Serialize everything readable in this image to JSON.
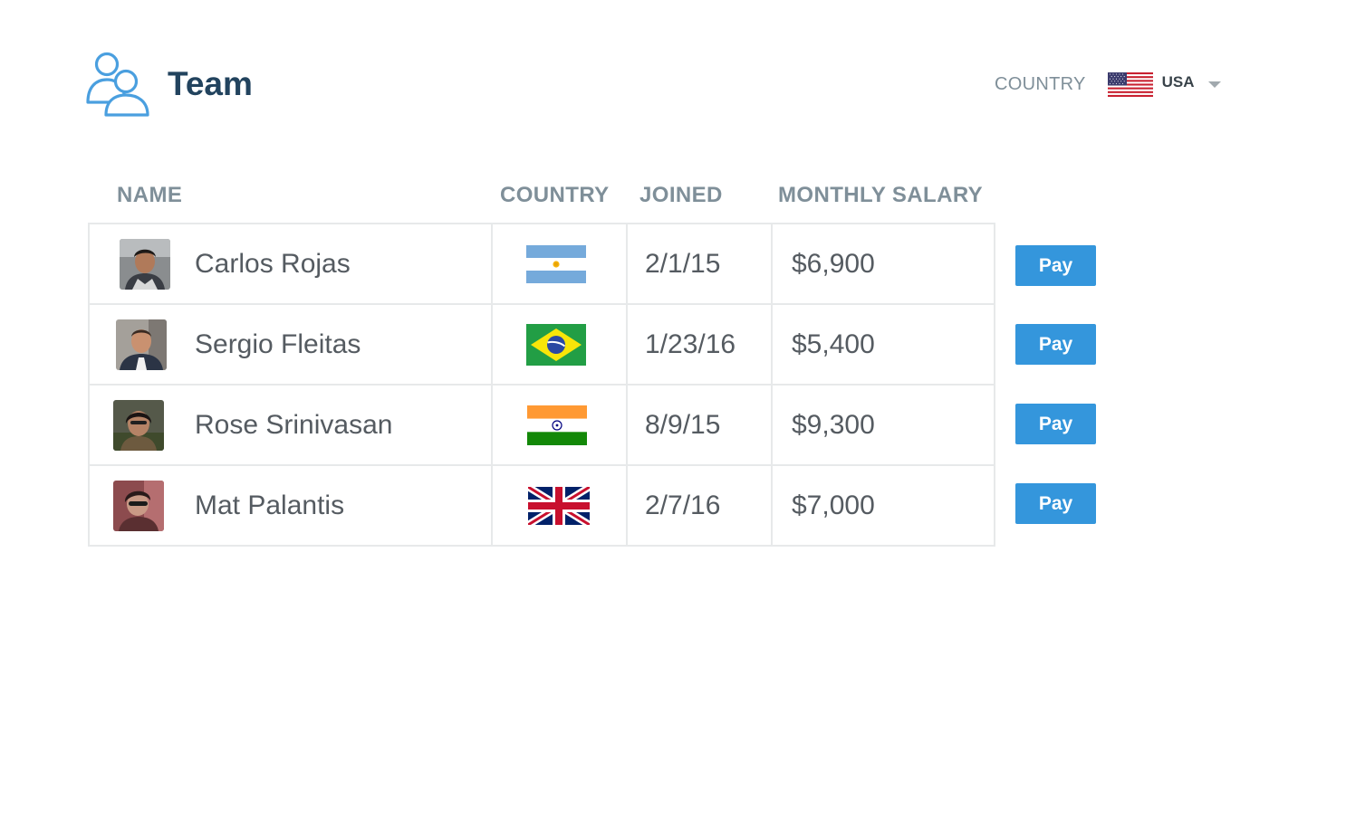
{
  "header": {
    "title": "Team",
    "icon": "users-icon"
  },
  "country_filter": {
    "label": "COUNTRY",
    "selected_value": "USA",
    "selected_flag": "usa-flag-icon"
  },
  "table": {
    "columns": [
      "NAME",
      "COUNTRY",
      "JOINED",
      "MONTHLY SALARY"
    ],
    "rows": [
      {
        "name": "Carlos Rojas",
        "country_flag": "argentina-flag-icon",
        "joined": "2/1/15",
        "salary": "$6,900",
        "action": "Pay"
      },
      {
        "name": "Sergio Fleitas",
        "country_flag": "brazil-flag-icon",
        "joined": "1/23/16",
        "salary": "$5,400",
        "action": "Pay"
      },
      {
        "name": "Rose Srinivasan",
        "country_flag": "india-flag-icon",
        "joined": "8/9/15",
        "salary": "$9,300",
        "action": "Pay"
      },
      {
        "name": "Mat Palantis",
        "country_flag": "uk-flag-icon",
        "joined": "2/7/16",
        "salary": "$7,000",
        "action": "Pay"
      }
    ]
  },
  "colors": {
    "title": "#22435e",
    "accent": "#3496dc",
    "icon": "#4a9fdf",
    "header_text": "#7f8f99",
    "body_text": "#555b61",
    "border": "#e7e9ea"
  }
}
